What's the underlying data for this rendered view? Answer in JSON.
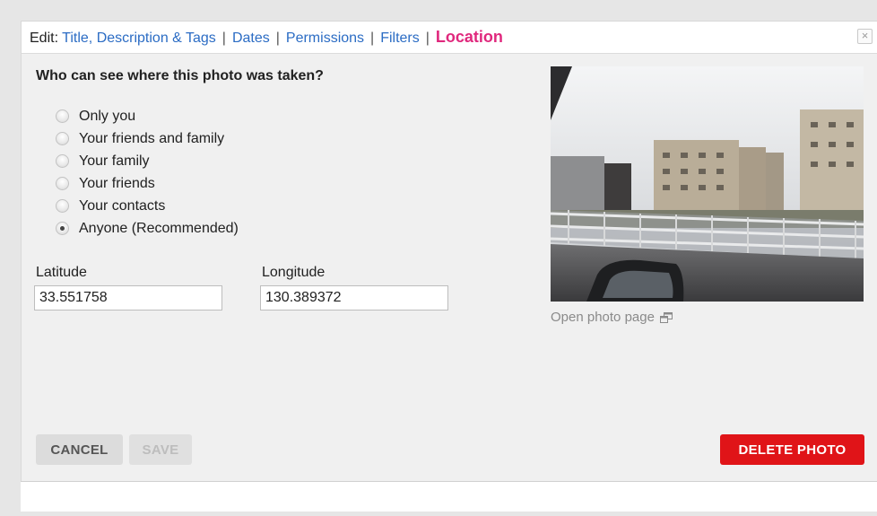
{
  "header": {
    "edit_label": "Edit:",
    "tabs": [
      {
        "label": "Title, Description & Tags"
      },
      {
        "label": "Dates"
      },
      {
        "label": "Permissions"
      },
      {
        "label": "Filters"
      },
      {
        "label": "Location"
      }
    ],
    "separator": "|",
    "close_glyph": "×"
  },
  "location": {
    "question": "Who can see where this photo was taken?",
    "options": [
      {
        "label": "Only you",
        "checked": false
      },
      {
        "label": "Your friends and family",
        "checked": false
      },
      {
        "label": "Your family",
        "checked": false
      },
      {
        "label": "Your friends",
        "checked": false
      },
      {
        "label": "Your contacts",
        "checked": false
      },
      {
        "label": "Anyone (Recommended)",
        "checked": true
      }
    ],
    "latitude_label": "Latitude",
    "latitude_value": "33.551758",
    "longitude_label": "Longitude",
    "longitude_value": "130.389372"
  },
  "photo": {
    "open_link": "Open photo page",
    "link_icon": "external-window-icon"
  },
  "buttons": {
    "cancel": "CANCEL",
    "save": "SAVE",
    "delete": "DELETE PHOTO"
  },
  "colors": {
    "link": "#2b6cc4",
    "active_tab": "#e0287d",
    "delete": "#e01418"
  }
}
